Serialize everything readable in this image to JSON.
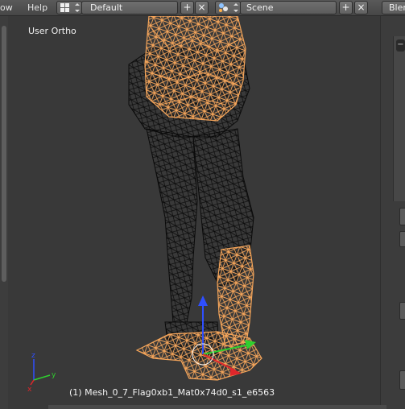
{
  "menu": {
    "window_partial": "ow",
    "help": "Help"
  },
  "screen_layout": {
    "value": "Default"
  },
  "scene": {
    "value": "Scene"
  },
  "engine_partial": "Blen",
  "viewport": {
    "view_label": "User Ortho",
    "object_label": "(1) Mesh_0_7_Flag0xb1_Mat0x74d0_s1_e6563"
  },
  "icons": {
    "layout_icon": "grid-icon",
    "scene_icon": "scene-icon",
    "add": "+",
    "close": "×",
    "spinner": "⇕"
  },
  "colors": {
    "selected_wire": "#f5a55a",
    "unselected_wire": "#0e0e0e",
    "axis_x": "#e0262b",
    "axis_y": "#2fcf2f",
    "axis_z": "#2f4fff"
  }
}
